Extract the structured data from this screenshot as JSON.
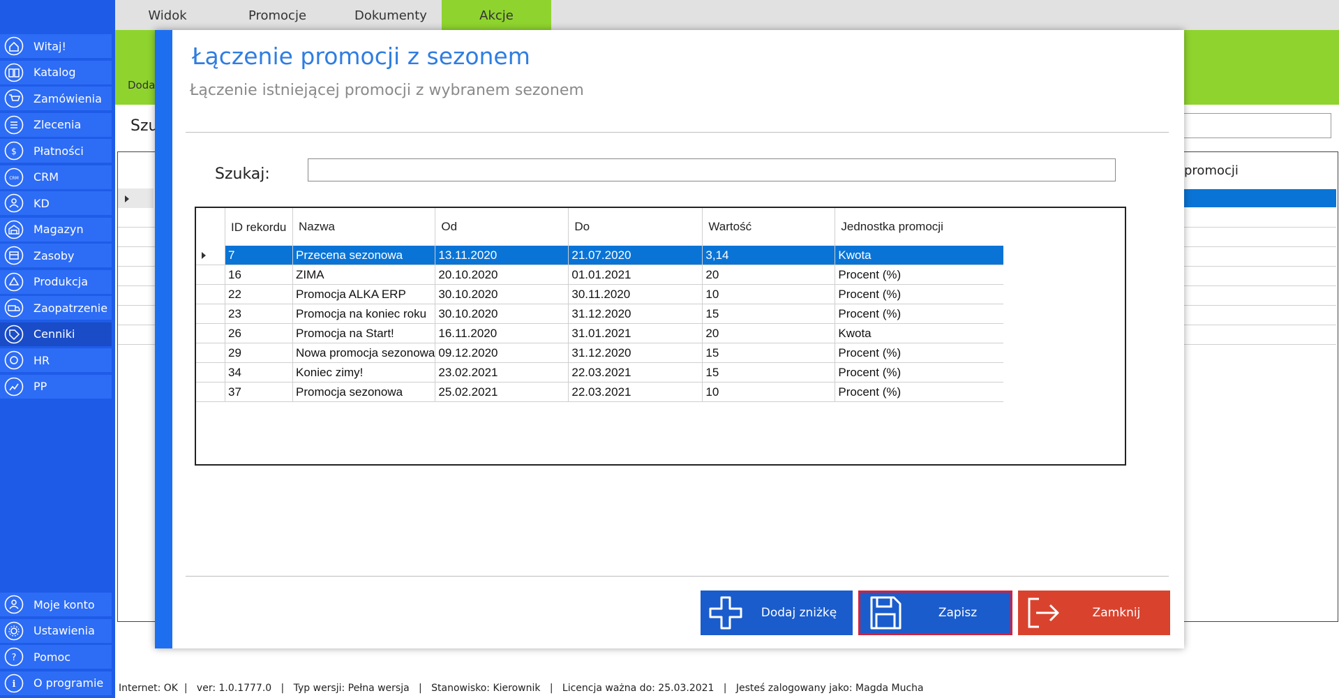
{
  "sidebar": {
    "items": [
      {
        "label": "Witaj!",
        "icon": "home-icon"
      },
      {
        "label": "Katalog",
        "icon": "book-icon"
      },
      {
        "label": "Zamówienia",
        "icon": "cart-icon"
      },
      {
        "label": "Zlecenia",
        "icon": "list-icon"
      },
      {
        "label": "Płatności",
        "icon": "dollar-icon"
      },
      {
        "label": "CRM",
        "icon": "crm-icon"
      },
      {
        "label": "KD",
        "icon": "user-icon"
      },
      {
        "label": "Magazyn",
        "icon": "warehouse-icon"
      },
      {
        "label": "Zasoby",
        "icon": "resources-icon"
      },
      {
        "label": "Produkcja",
        "icon": "production-icon"
      },
      {
        "label": "Zaopatrzenie",
        "icon": "truck-icon"
      },
      {
        "label": "Cenniki",
        "icon": "tag-icon"
      },
      {
        "label": "HR",
        "icon": "hr-icon"
      },
      {
        "label": "PP",
        "icon": "pp-icon"
      }
    ],
    "bottom_items": [
      {
        "label": "Moje konto",
        "icon": "account-icon"
      },
      {
        "label": "Ustawienia",
        "icon": "gear-icon"
      },
      {
        "label": "Pomoc",
        "icon": "help-icon"
      },
      {
        "label": "O programie",
        "icon": "info-icon"
      }
    ]
  },
  "topbar": {
    "tabs": [
      "Widok",
      "Promocje",
      "Dokumenty",
      "Akcje"
    ],
    "active_tab": "Akcje"
  },
  "background": {
    "ribbon_label": "Doda",
    "search_label": "Szu",
    "grid_header_fragment": "promocji"
  },
  "dialog": {
    "title": "Łączenie promocji z sezonem",
    "subtitle": "Łączenie istniejącej promocji z wybranem sezonem",
    "search_label": "Szukaj:",
    "search_value": "",
    "columns": [
      "ID rekordu",
      "Nazwa",
      "Od",
      "Do",
      "Wartość",
      "Jednostka promocji"
    ],
    "rows": [
      [
        "7",
        "Przecena sezonowa",
        "13.11.2020",
        "21.07.2020",
        "3,14",
        "Kwota"
      ],
      [
        "16",
        "ZIMA",
        "20.10.2020",
        "01.01.2021",
        "20",
        "Procent (%)"
      ],
      [
        "22",
        "Promocja ALKA ERP",
        "30.10.2020",
        "30.11.2020",
        "10",
        "Procent (%)"
      ],
      [
        "23",
        "Promocja na koniec roku",
        "30.10.2020",
        "31.12.2020",
        "15",
        "Procent (%)"
      ],
      [
        "26",
        "Promocja na Start!",
        "16.11.2020",
        "31.01.2021",
        "20",
        "Kwota"
      ],
      [
        "29",
        "Nowa promocja sezonowa",
        "09.12.2020",
        "31.12.2020",
        "15",
        "Procent (%)"
      ],
      [
        "34",
        "Koniec zimy!",
        "23.02.2021",
        "22.03.2021",
        "15",
        "Procent (%)"
      ],
      [
        "37",
        "Promocja sezonowa",
        "25.02.2021",
        "22.03.2021",
        "10",
        "Procent (%)"
      ]
    ],
    "selected_row": 0,
    "buttons": {
      "add": "Dodaj zniżkę",
      "save": "Zapisz",
      "close": "Zamknij"
    }
  },
  "statusbar": {
    "text": "Internet: OK  |   ver: 1.0.1777.0   |   Typ wersji: Pełna wersja   |   Stanowisko: Kierownik   |   Licencja ważna do: 25.03.2021   |   Jesteś zalogowany jako: Magda Mucha"
  },
  "colors": {
    "sidebar": "#1e5ce8",
    "accent_green": "#8fd42e",
    "title_blue": "#2f7de1",
    "selection": "#0a74d6",
    "btn_add": "#1a5ccc",
    "btn_save": "#1a5ccc",
    "btn_save_border": "#d4203a",
    "btn_close": "#d9432e"
  }
}
